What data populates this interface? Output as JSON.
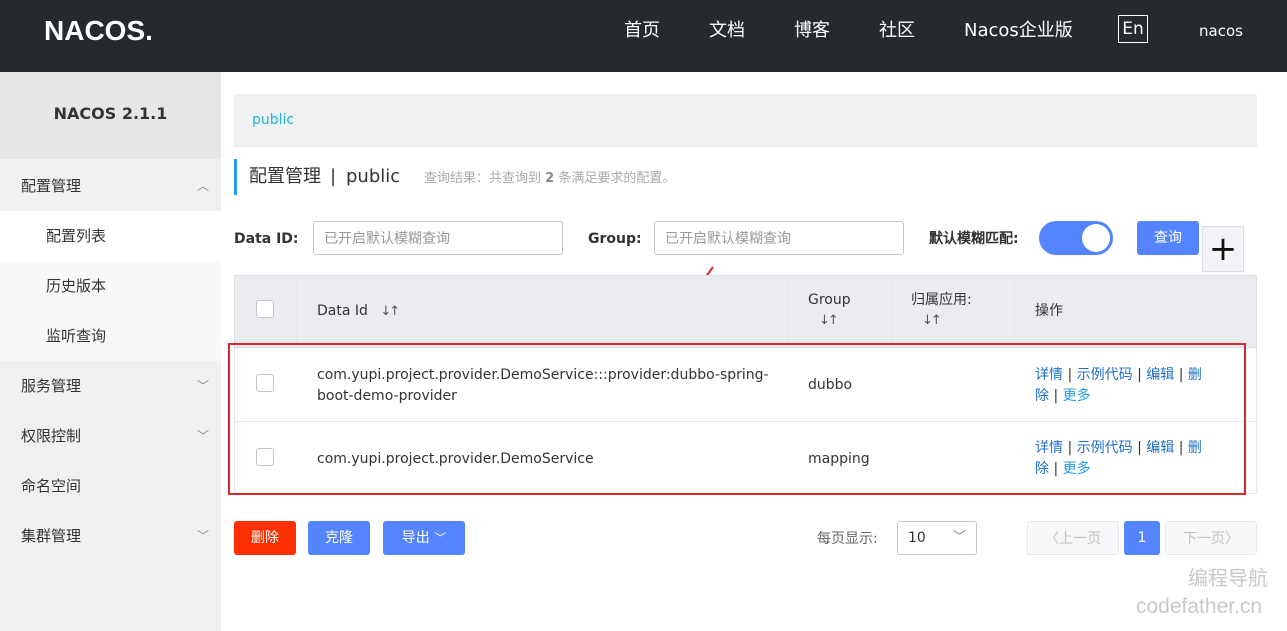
{
  "header": {
    "logo_text": "NACOS.",
    "nav": [
      "首页",
      "文档",
      "博客",
      "社区",
      "Nacos企业版"
    ],
    "lang": "En",
    "user": "nacos"
  },
  "sidebar": {
    "title": "NACOS 2.1.1",
    "items": [
      {
        "label": "配置管理"
      },
      {
        "label": "配置列表"
      },
      {
        "label": "历史版本"
      },
      {
        "label": "监听查询"
      },
      {
        "label": "服务管理"
      },
      {
        "label": "权限控制"
      },
      {
        "label": "命名空间"
      },
      {
        "label": "集群管理"
      }
    ]
  },
  "breadcrumb": {
    "namespace": "public"
  },
  "page": {
    "title": "配置管理",
    "separator": "|",
    "namespace": "public",
    "result_prefix": "查询结果：共查询到",
    "result_count": "2",
    "result_suffix": "条满足要求的配置。"
  },
  "form": {
    "dataid_label": "Data ID:",
    "dataid_placeholder": "已开启默认模糊查询",
    "group_label": "Group:",
    "group_placeholder": "已开启默认模糊查询",
    "fuzzy_label": "默认模糊匹配:",
    "fuzzy_on": true,
    "query_button": "查询",
    "add_button": "+"
  },
  "table": {
    "headers": {
      "dataid": "Data Id",
      "group": "Group",
      "app": "归属应用:",
      "ops": "操作"
    },
    "rows": [
      {
        "dataid_line1": "com.yupi.project.provider.DemoService:::provider:dubbo-spring-",
        "dataid_line2": "boot-demo-provider",
        "group": "dubbo",
        "app": ""
      },
      {
        "dataid_line1": "com.yupi.project.provider.DemoService",
        "dataid_line2": "",
        "group": "mapping",
        "app": ""
      }
    ],
    "ops": {
      "detail": "详情",
      "sample": "示例代码",
      "edit": "编辑",
      "delete_a": "删",
      "delete_b": "除",
      "more": "更多",
      "sep": "|"
    }
  },
  "actions": {
    "delete": "删除",
    "clone": "克隆",
    "export": "导出"
  },
  "pagination": {
    "size_label": "每页显示:",
    "size": "10",
    "prev": "上一页",
    "current": "1",
    "next": "下一页"
  },
  "watermark": {
    "line1": "编程导航",
    "line2": "codefather.cn"
  },
  "colors": {
    "primary": "#5584ff",
    "danger": "#ff3000",
    "annotation": "#d8282e",
    "topbar": "#252a2f"
  }
}
